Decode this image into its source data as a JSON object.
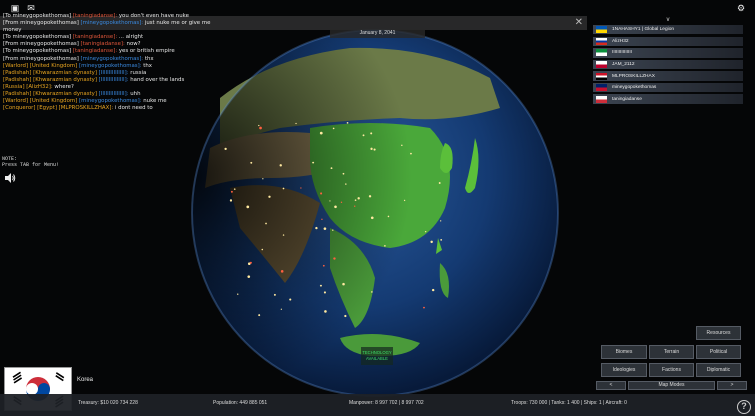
{
  "top_icons": {
    "roblox": "roblox-menu-icon",
    "chat": "chat-bubble-icon",
    "settings": "settings-icon"
  },
  "date": "January 8, 2041",
  "chat": [
    {
      "prefix": "[To mineygopokethomas]",
      "prefix_color": "#e8e8e8",
      "name": " [taningiadanse]:",
      "name_color": "#e0563a",
      "text": " you don't even have nuke"
    },
    {
      "prefix": "[From mineygopokethomas]",
      "prefix_color": "#e8e8e8",
      "name": " [mineygopokethomas]:",
      "name_color": "#3a8ae0",
      "text": " just nuke me or give me"
    },
    {
      "prefix": "money",
      "prefix_color": "#e8e8e8",
      "name": "",
      "name_color": "#e8e8e8",
      "text": ""
    },
    {
      "prefix": "[To mineygopokethomas]",
      "prefix_color": "#e8e8e8",
      "name": " [taningiadanse]:",
      "name_color": "#e0563a",
      "text": " ... alright"
    },
    {
      "prefix": "[From mineygopokethomas]",
      "prefix_color": "#e8e8e8",
      "name": " [taningiadanse]:",
      "name_color": "#e0563a",
      "text": " now?"
    },
    {
      "prefix": "[To mineygopokethomas]",
      "prefix_color": "#e8e8e8",
      "name": " [taningiadanse]:",
      "name_color": "#e0563a",
      "text": " yes or british empire"
    },
    {
      "prefix": "[From mineygopokethomas]",
      "prefix_color": "#e8e8e8",
      "name": " [mineygopokethomas]:",
      "name_color": "#3a8ae0",
      "text": " thx"
    },
    {
      "prefix": "[Warlord] [United Kingdom]",
      "prefix_color": "#e8a520",
      "name": " [mineygopokethomas]:",
      "name_color": "#3a8ae0",
      "text": " thx"
    },
    {
      "prefix": "[Padishah] [Khwarazmian dynasty]",
      "prefix_color": "#e8a520",
      "name": " [IIIIIIIIIIIIIII]:",
      "name_color": "#3a8ae0",
      "text": " russia"
    },
    {
      "prefix": "[Padishah] [Khwarazmian dynasty]",
      "prefix_color": "#e8a520",
      "name": " [IIIIIIIIIIIIIII]:",
      "name_color": "#3a8ae0",
      "text": " hand over the lands"
    },
    {
      "prefix": "[Russia] [AlizH32]:",
      "prefix_color": "#e8a520",
      "name": "",
      "name_color": "#e8e8e8",
      "text": " where?"
    },
    {
      "prefix": "[Padishah] [Khwarazmian dynasty]",
      "prefix_color": "#e8a520",
      "name": " [IIIIIIIIIIIIIII]:",
      "name_color": "#3a8ae0",
      "text": " uhh"
    },
    {
      "prefix": "[Warlord] [United Kingdom]",
      "prefix_color": "#e8a520",
      "name": " [mineygopokethomas]:",
      "name_color": "#3a8ae0",
      "text": " nuke me"
    },
    {
      "prefix": "[Conqueror] [Egypt] [MLPROSKILLZHAX]:",
      "prefix_color": "#e8a520",
      "name": "",
      "name_color": "#e8e8e8",
      "text": " i dont need to"
    }
  ],
  "note": [
    "NOTE:",
    "Press TAB for Menu!"
  ],
  "players_header": "v",
  "players": [
    {
      "name": "1NAHASHY1 | Global Legion",
      "flag": [
        "#0057b7",
        "#ffd700"
      ]
    },
    {
      "name": "AlizH32",
      "flag": [
        "#ffffff",
        "#0039a6",
        "#d52b1e"
      ]
    },
    {
      "name": "IIIIIIIIIIIIIII",
      "flag": [
        "#0a8f3c",
        "#ffffff"
      ]
    },
    {
      "name": "JAM_2112",
      "flag": [
        "#ffffff",
        "#bc002d"
      ]
    },
    {
      "name": "MLPROSKILLZHAX",
      "flag": [
        "#ce1126",
        "#ffffff",
        "#000000"
      ]
    },
    {
      "name": "mineygopokethomas",
      "flag": [
        "#012169",
        "#c8102e"
      ]
    },
    {
      "name": "taningiadanse",
      "flag": [
        "#ffffff",
        "#cd2e3a"
      ]
    }
  ],
  "tech_notice": [
    "TECHNOLOGY",
    "AVAILABLE"
  ],
  "map_buttons": {
    "resources": "Resources",
    "biomes": "Biomes",
    "terrain": "Terrain",
    "political": "Political",
    "ideologies": "Ideologies",
    "factions": "Factions",
    "diplomatic": "Diplomatic",
    "prev": "<",
    "map_modes": "Map Modes",
    "next": ">"
  },
  "country": "Korea",
  "stats": {
    "treasury": "Treasury:  $10 020 734 228",
    "population": "Population: 449 885 051",
    "manpower": "Manpower:   8 997 702  |  8 997 702",
    "military": "Troops: 730 000  |  Tanks: 1 400  |  Ships: 1  |  Aircraft: 0"
  },
  "help": "?"
}
